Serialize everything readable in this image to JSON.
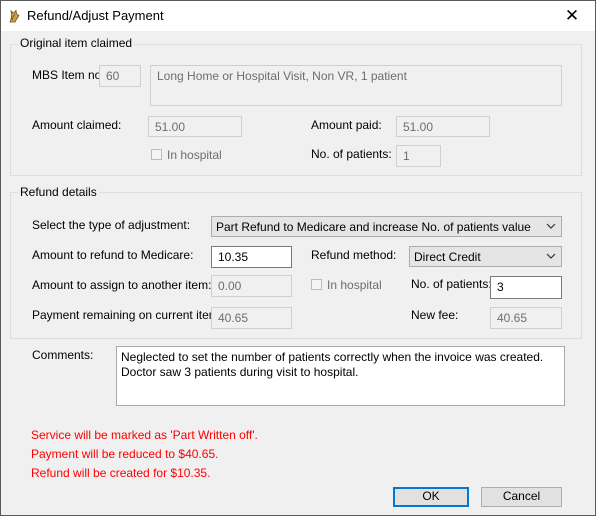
{
  "window": {
    "title": "Refund/Adjust Payment",
    "close_glyph": "✕"
  },
  "original_item": {
    "group_title": "Original item claimed",
    "mbs_label": "MBS Item no:",
    "mbs_value": "60",
    "description": "Long Home or Hospital Visit, Non VR, 1 patient",
    "amount_claimed_label": "Amount claimed:",
    "amount_claimed_value": "51.00",
    "amount_paid_label": "Amount paid:",
    "amount_paid_value": "51.00",
    "in_hospital_label": "In hospital",
    "in_hospital_checked": false,
    "patients_label": "No. of patients:",
    "patients_value": "1"
  },
  "refund_details": {
    "group_title": "Refund details",
    "adjustment_type_label": "Select the type of adjustment:",
    "adjustment_type_value": "Part Refund to Medicare and increase No. of patients value",
    "refund_amount_label": "Amount to refund to Medicare:",
    "refund_amount_value": "10.35",
    "refund_method_label": "Refund method:",
    "refund_method_value": "Direct Credit",
    "assign_label": "Amount to assign to another item:",
    "assign_value": "0.00",
    "in_hospital_label": "In hospital",
    "in_hospital_checked": false,
    "patients_label": "No. of patients:",
    "patients_value": "3",
    "remaining_label": "Payment remaining on current item:",
    "remaining_value": "40.65",
    "new_fee_label": "New fee:",
    "new_fee_value": "40.65"
  },
  "comments": {
    "label": "Comments:",
    "text": "Neglected to set the number of patients correctly when the invoice was created. Doctor saw 3 patients during visit to hospital."
  },
  "messages": [
    "Service will be marked as 'Part Written off'.",
    "Payment will be reduced to $40.65.",
    "Refund will be created for $10.35."
  ],
  "buttons": {
    "ok": "OK",
    "cancel": "Cancel"
  },
  "colors": {
    "message_text": "#ff0000",
    "default_button_border": "#0078d7"
  }
}
